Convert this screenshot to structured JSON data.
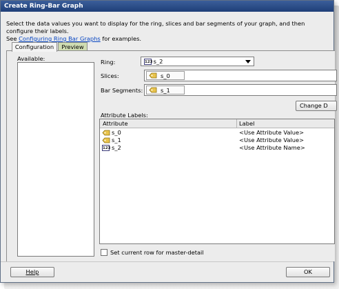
{
  "dialog": {
    "title": "Create Ring-Bar Graph",
    "intro_text": "Select the data values you want to display for the ring, slices and bar segments of your graph, and then configure their labels.",
    "intro_see": "See ",
    "intro_link": "Configuring Ring Bar Graphs",
    "intro_after": " for examples."
  },
  "tabs": [
    {
      "label": "Configuration",
      "active": true
    },
    {
      "label": "Preview",
      "active": false
    }
  ],
  "available": {
    "label": "Available:"
  },
  "ring": {
    "label": "Ring:",
    "value": "s_2",
    "icon": "numeric-icon"
  },
  "slices": {
    "label": "Slices:",
    "chip": "s_0",
    "icon": "tag-icon"
  },
  "bar_segments": {
    "label": "Bar Segments:",
    "chip": "s_1",
    "icon": "tag-icon"
  },
  "change_button": {
    "label": "Change D"
  },
  "attribute_labels": {
    "label": "Attribute Labels:",
    "columns": [
      "Attribute",
      "Label"
    ],
    "rows": [
      {
        "icon": "tag-icon",
        "attribute": "s_0",
        "label": "<Use Attribute Value>"
      },
      {
        "icon": "tag-icon",
        "attribute": "s_1",
        "label": "<Use Attribute Value>"
      },
      {
        "icon": "numeric-icon",
        "attribute": "s_2",
        "label": "<Use Attribute Name>"
      }
    ]
  },
  "master_detail": {
    "label": "Set current row for master-detail",
    "checked": false
  },
  "footer": {
    "help_label": "Help",
    "ok_label": "OK"
  },
  "colors": {
    "title_bar": "#2a4c8a",
    "link": "#0645c2",
    "inactive_tab": "#cfdcb2",
    "tag_icon": "#c9a227"
  }
}
